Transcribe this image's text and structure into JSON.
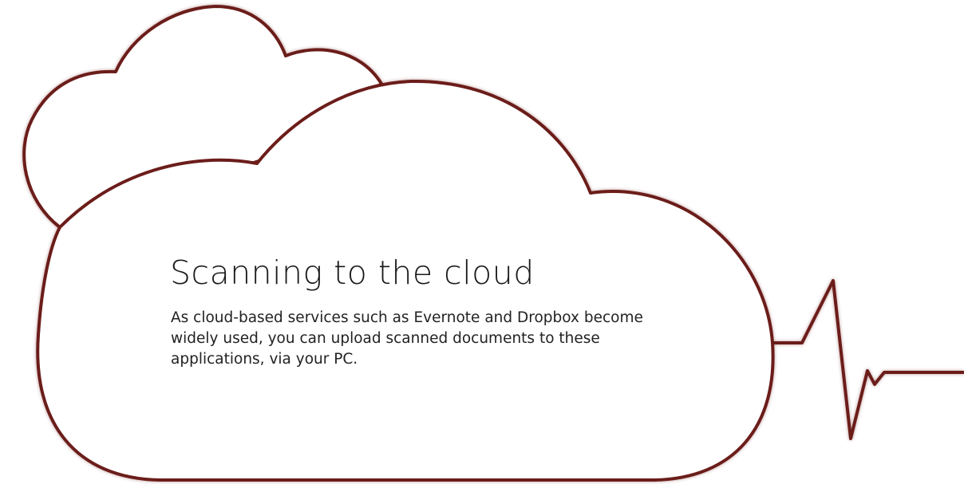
{
  "section": {
    "title": "Scanning to the cloud",
    "description": "As cloud-based services such as Evernote and Dropbox become widely used, you can upload scanned documents to these applications, via your PC."
  },
  "colors": {
    "outline": "#6b1d1a",
    "text": "#1a1a1a",
    "background": "#ffffff"
  },
  "illustration": {
    "icons": [
      "small-cloud-icon",
      "large-cloud-icon",
      "heartbeat-line-icon"
    ]
  }
}
